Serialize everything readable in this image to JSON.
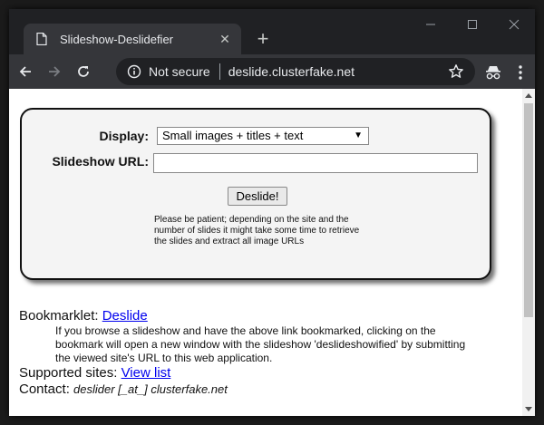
{
  "browser": {
    "tab_title": "Slideshow-Deslidefier",
    "secure_label": "Not secure",
    "url": "deslide.clusterfake.net"
  },
  "form": {
    "display_label": "Display:",
    "display_selected": "Small images + titles + text",
    "url_label": "Slideshow URL:",
    "url_value": "",
    "button_label": "Deslide!",
    "patience_note": "Please be patient; depending on the site and the number of slides it might take some time to retrieve the slides and extract all image URLs"
  },
  "info": {
    "bookmarklet_label": "Bookmarklet:",
    "bookmarklet_link": "Deslide",
    "bookmarklet_desc": "If you browse a slideshow and have the above link bookmarked, clicking on the bookmark will open a new window with the slideshow 'deslideshowified' by submitting the viewed site's URL to this web application.",
    "supported_label": "Supported sites:",
    "supported_link": "View list",
    "contact_label": "Contact:",
    "contact_value": "deslider [_at_] clusterfake.net"
  },
  "colors": {
    "chrome_dark": "#202124",
    "toolbar": "#35363a",
    "link": "#0000ee"
  }
}
